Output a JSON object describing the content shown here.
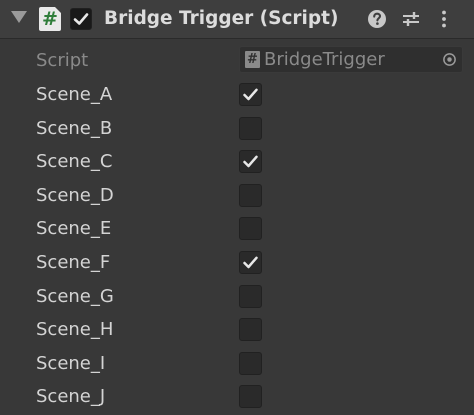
{
  "component": {
    "title": "Bridge Trigger (Script)",
    "script_icon_glyph": "#",
    "enabled": true,
    "icons": {
      "foldout": "foldout-expanded-icon",
      "help": "help-icon",
      "presets": "presets-sliders-icon",
      "menu": "context-menu-kebab-icon"
    }
  },
  "script_field": {
    "label": "Script",
    "value": "BridgeTrigger",
    "icon_glyph": "#"
  },
  "fields": [
    {
      "label": "Scene_A",
      "checked": true
    },
    {
      "label": "Scene_B",
      "checked": false
    },
    {
      "label": "Scene_C",
      "checked": true
    },
    {
      "label": "Scene_D",
      "checked": false
    },
    {
      "label": "Scene_E",
      "checked": false
    },
    {
      "label": "Scene_F",
      "checked": true
    },
    {
      "label": "Scene_G",
      "checked": false
    },
    {
      "label": "Scene_H",
      "checked": false
    },
    {
      "label": "Scene_I",
      "checked": false
    },
    {
      "label": "Scene_J",
      "checked": false
    }
  ],
  "colors": {
    "background": "#383838",
    "header": "#3e3e3e",
    "checkbox": "#2a2a2a",
    "checkmark": "#e8e8e8",
    "script_icon_green": "#2f7d3a"
  }
}
